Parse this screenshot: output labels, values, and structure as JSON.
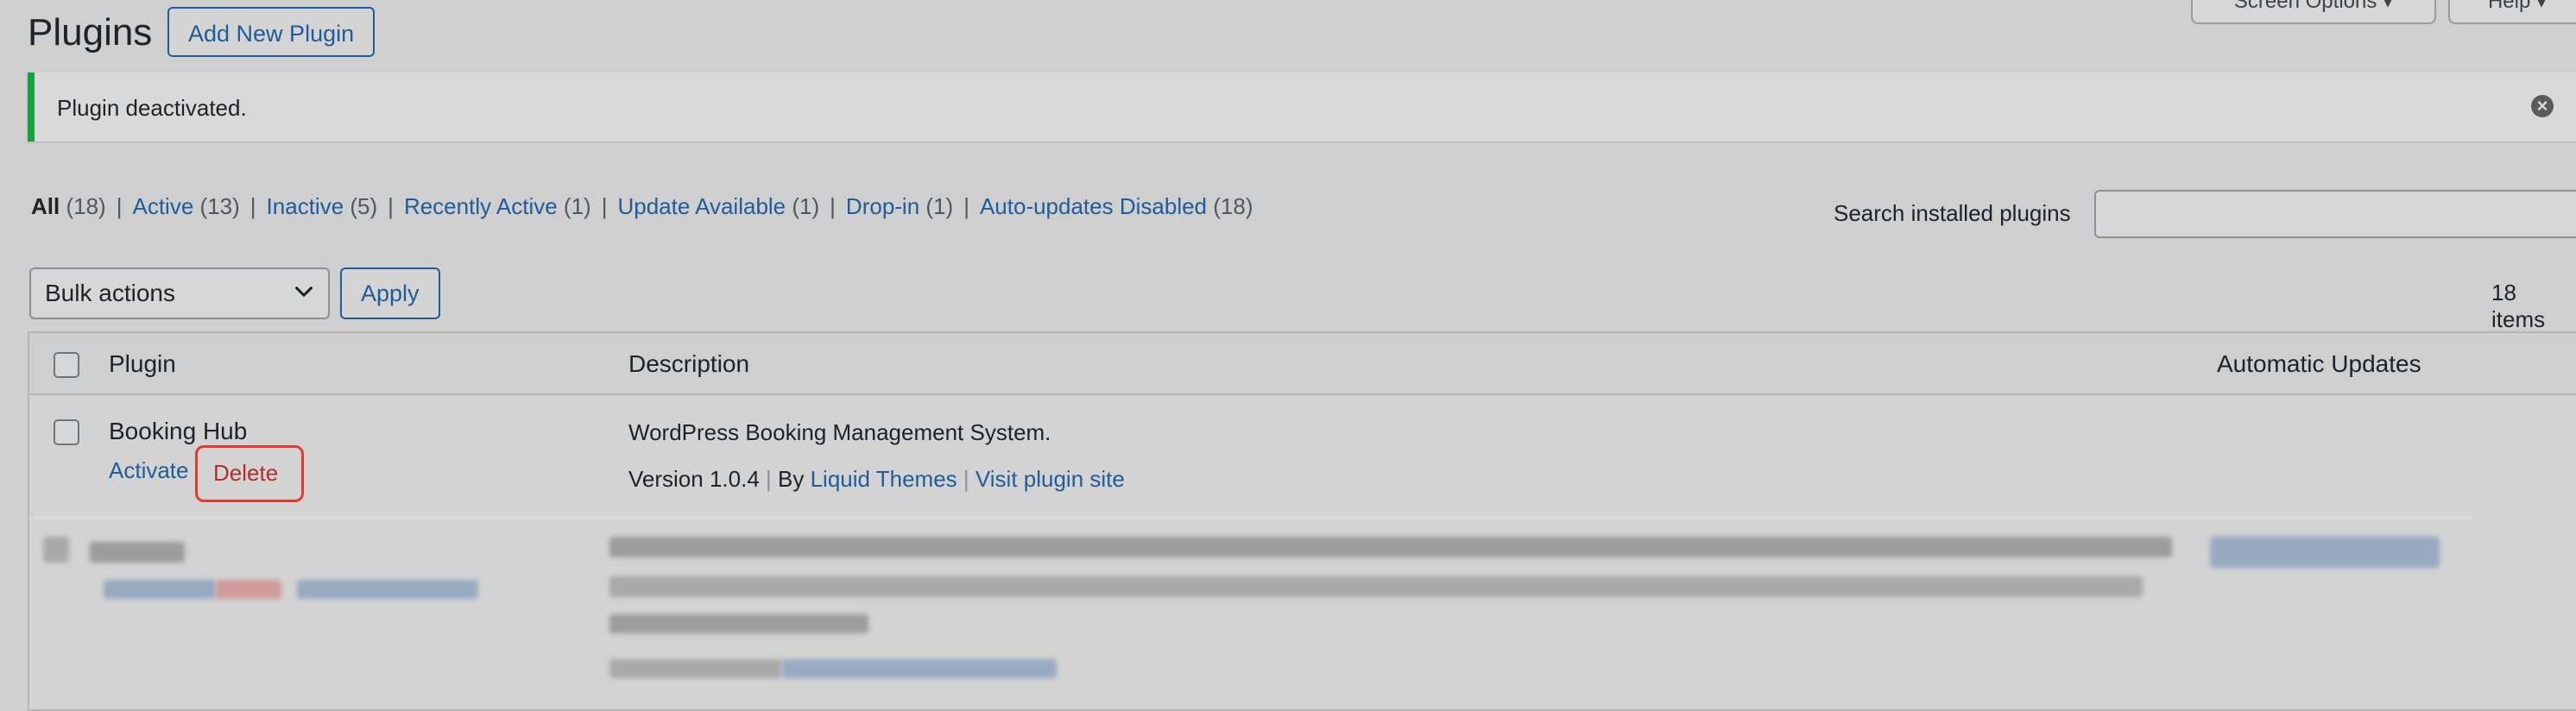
{
  "header": {
    "title": "Plugins",
    "add_new_label": "Add New Plugin",
    "screen_options_label": "Screen Options ▾",
    "help_label": "Help ▾"
  },
  "notice": {
    "text": "Plugin deactivated.",
    "dismiss_icon": "close-circle-icon",
    "accent_color": "#14a33b"
  },
  "filters": [
    {
      "label": "All",
      "count": "(18)",
      "current": true
    },
    {
      "label": "Active",
      "count": "(13)"
    },
    {
      "label": "Inactive",
      "count": "(5)"
    },
    {
      "label": "Recently Active",
      "count": "(1)"
    },
    {
      "label": "Update Available",
      "count": "(1)"
    },
    {
      "label": "Drop-in",
      "count": "(1)"
    },
    {
      "label": "Auto-updates Disabled",
      "count": "(18)"
    }
  ],
  "search": {
    "label": "Search installed plugins",
    "value": ""
  },
  "bulk": {
    "selected": "Bulk actions",
    "apply_label": "Apply",
    "item_count": "18 items"
  },
  "table": {
    "headers": {
      "plugin": "Plugin",
      "description": "Description",
      "auto_updates": "Automatic Updates"
    },
    "row": {
      "name": "Booking Hub",
      "activate_label": "Activate",
      "separator": "|",
      "delete_label": "Delete",
      "description": "WordPress Booking Management System.",
      "version": "Version 1.0.4",
      "by_prefix": "By",
      "author": "Liquid Themes",
      "visit_label": "Visit plugin site"
    }
  },
  "colors": {
    "link": "#1f5c99",
    "delete": "#b32d2e",
    "highlight_border": "#e5382e"
  }
}
